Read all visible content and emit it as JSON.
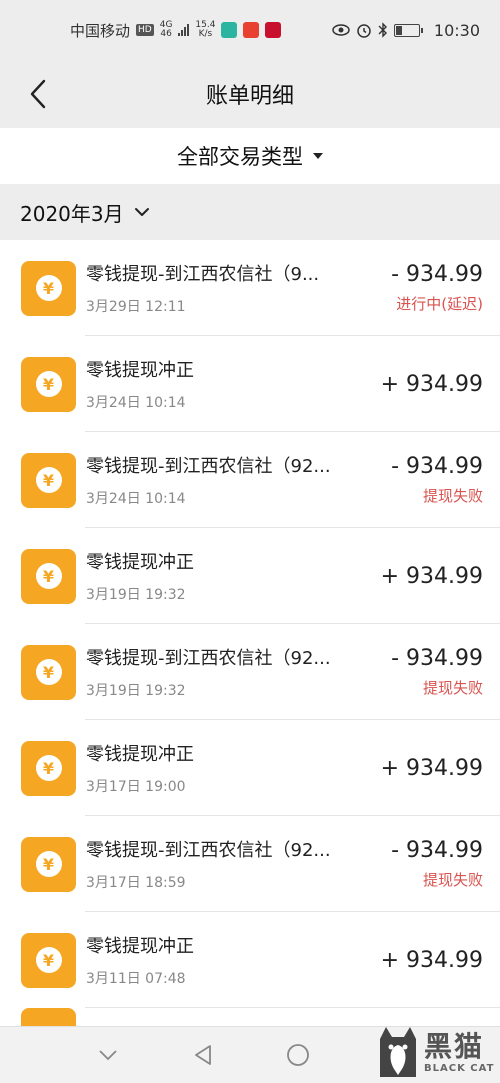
{
  "status_bar": {
    "carrier": "中国移动",
    "hd": "HD",
    "network_top": "4G",
    "network_bottom": "46",
    "speed_value": "15.4",
    "speed_unit": "K/s",
    "time": "10:30",
    "icons": [
      "eye-icon",
      "alarm-icon",
      "bluetooth-icon",
      "battery-icon"
    ]
  },
  "header": {
    "title": "账单明细",
    "back_icon": "chevron-left-icon"
  },
  "filter": {
    "label": "全部交易类型"
  },
  "month": {
    "label": "2020年3月"
  },
  "transactions": [
    {
      "title": "零钱提现-到江西农信社（9...",
      "date": "3月29日 12:11",
      "amount": "- 934.99",
      "status": "进行中(延迟)"
    },
    {
      "title": "零钱提现冲正",
      "date": "3月24日 10:14",
      "amount": "+ 934.99",
      "status": ""
    },
    {
      "title": "零钱提现-到江西农信社（92...",
      "date": "3月24日 10:14",
      "amount": "- 934.99",
      "status": "提现失败"
    },
    {
      "title": "零钱提现冲正",
      "date": "3月19日 19:32",
      "amount": "+ 934.99",
      "status": ""
    },
    {
      "title": "零钱提现-到江西农信社（92...",
      "date": "3月19日 19:32",
      "amount": "- 934.99",
      "status": "提现失败"
    },
    {
      "title": "零钱提现冲正",
      "date": "3月17日 19:00",
      "amount": "+ 934.99",
      "status": ""
    },
    {
      "title": "零钱提现-到江西农信社（92...",
      "date": "3月17日 18:59",
      "amount": "- 934.99",
      "status": "提现失败"
    },
    {
      "title": "零钱提现冲正",
      "date": "3月11日 07:48",
      "amount": "+ 934.99",
      "status": ""
    }
  ],
  "icon_glyph": "¥",
  "colors": {
    "accent": "#f5a623",
    "status_red": "#d9534f",
    "background_gray": "#ededed"
  },
  "watermark": {
    "cn": "黑猫",
    "en": "BLACK CAT"
  }
}
